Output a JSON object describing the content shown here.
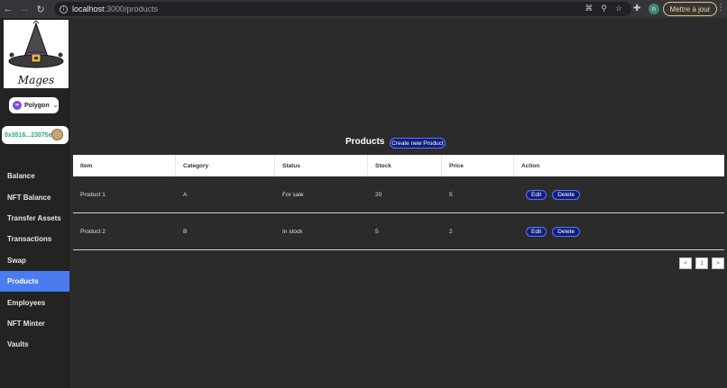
{
  "browser": {
    "url_host": "localhost",
    "url_path": ":3000/products",
    "update_label": "Mettre à jour",
    "profile_initial": "n"
  },
  "sidebar": {
    "logo_text": "Mages",
    "chain": {
      "label": "Polygon",
      "color": "#8247e5"
    },
    "wallet": {
      "address": "0x3516...23075e"
    },
    "items": [
      {
        "label": "Balance",
        "active": false
      },
      {
        "label": "NFT Balance",
        "active": false
      },
      {
        "label": "Transfer Assets",
        "active": false
      },
      {
        "label": "Transactions",
        "active": false
      },
      {
        "label": "Swap",
        "active": false
      },
      {
        "label": "Products",
        "active": true
      },
      {
        "label": "Employees",
        "active": false
      },
      {
        "label": "NFT Minter",
        "active": false
      },
      {
        "label": "Vaults",
        "active": false
      }
    ]
  },
  "main": {
    "title": "Products",
    "create_label": "Create new Product",
    "table": {
      "columns": [
        "Item",
        "Category",
        "Status",
        "Stock",
        "Price",
        "Action"
      ],
      "rows": [
        {
          "item": "Product 1",
          "category": "A",
          "status": "For sale",
          "stock": "20",
          "price": "5"
        },
        {
          "item": "Product 2",
          "category": "B",
          "status": "In stock",
          "stock": "5",
          "price": "2"
        }
      ],
      "edit_label": "Edit",
      "delete_label": "Delete"
    },
    "pagination": {
      "prev": "<",
      "current": "1",
      "next": ">"
    }
  },
  "colors": {
    "accent": "#4a7cf0",
    "button": "#101f7a",
    "address": "#2aa876"
  }
}
